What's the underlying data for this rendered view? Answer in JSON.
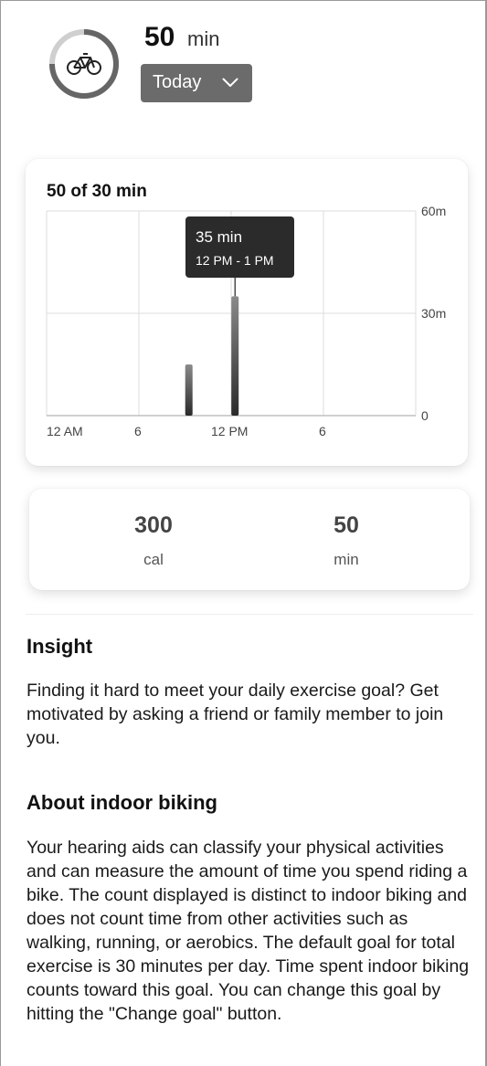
{
  "header": {
    "icon": "bike-icon",
    "value": "50",
    "unit": "min",
    "period": "Today"
  },
  "chart_data": {
    "type": "bar",
    "title": "50 of 30 min",
    "x_ticks": [
      "12 AM",
      "6",
      "12 PM",
      "6"
    ],
    "y_ticks": [
      "60m",
      "30m",
      "0"
    ],
    "ylim": [
      0,
      60
    ],
    "x_unit": "hour",
    "bars": [
      {
        "hour": 9,
        "value": 15
      },
      {
        "hour": 12,
        "value": 35
      }
    ],
    "tooltip": {
      "value": "35 min",
      "time": "12 PM - 1 PM",
      "hour": 12
    }
  },
  "summary": [
    {
      "value": "300",
      "unit": "cal"
    },
    {
      "value": "50",
      "unit": "min"
    }
  ],
  "insight": {
    "title": "Insight",
    "text": "Finding it hard to meet your daily exercise goal? Get motivated by asking a friend or family member to join you."
  },
  "about": {
    "title": "About indoor biking",
    "text": "Your hearing aids can classify your physical activities and can measure the amount of time you spend riding a bike. The count displayed is distinct to indoor biking and does not count time from other activities such as walking, running, or aerobics. The default goal for total exercise is 30 minutes per day. Time spent indoor biking counts toward this goal. You can change this goal by hitting the \"Change goal\" button."
  }
}
